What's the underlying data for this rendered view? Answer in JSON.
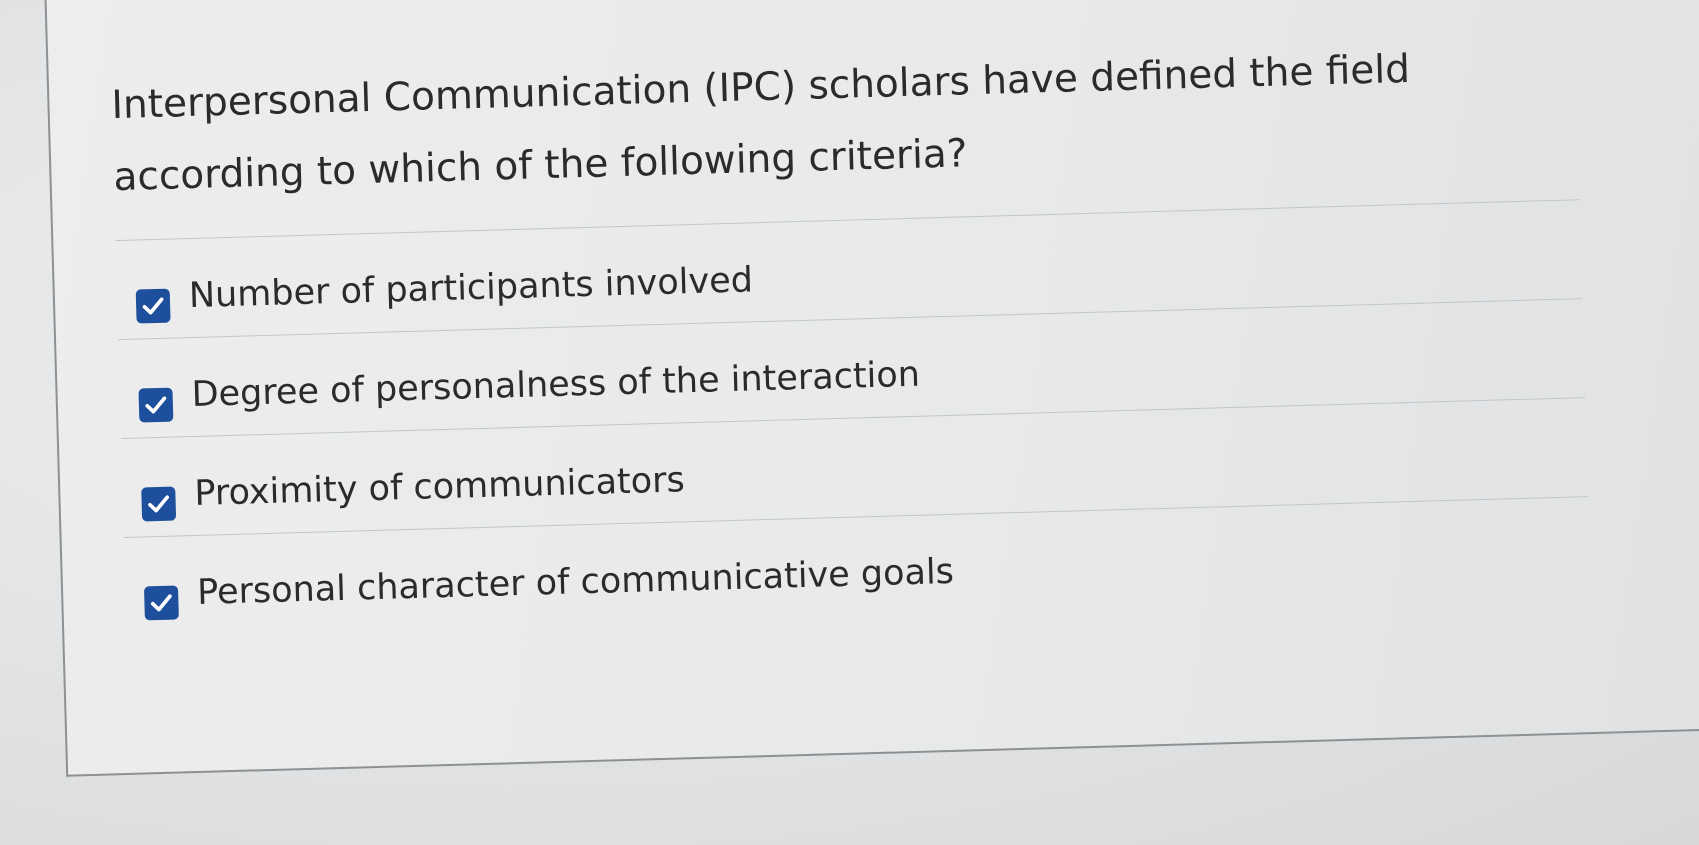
{
  "question": {
    "text": "Interpersonal Communication (IPC) scholars have defined the field according to which of the following criteria?"
  },
  "answers": [
    {
      "label": "Number of participants involved",
      "checked": true
    },
    {
      "label": "Degree of personalness of the interaction",
      "checked": true
    },
    {
      "label": "Proximity of communicators",
      "checked": true
    },
    {
      "label": "Personal character of communicative goals",
      "checked": true
    }
  ],
  "colors": {
    "checkbox": "#1d4f9c",
    "text": "#2a2b2d",
    "background": "#ebebeb"
  },
  "icons": {
    "checkbox": "checked-checkbox-icon"
  }
}
